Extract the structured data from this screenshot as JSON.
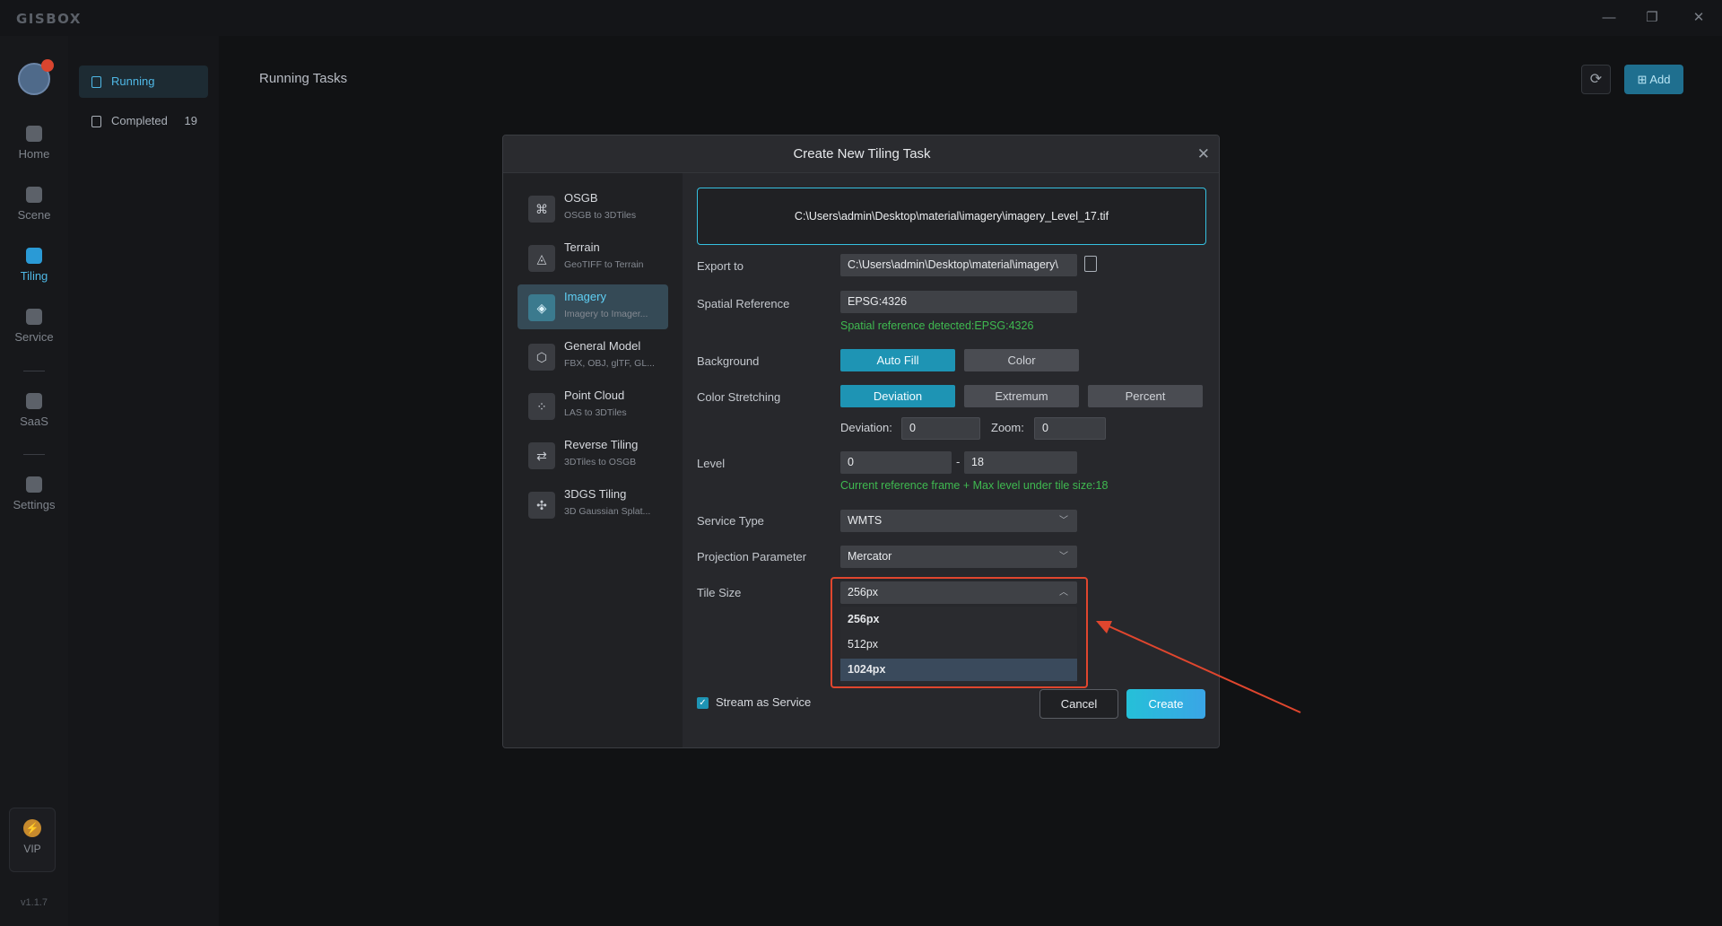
{
  "app": {
    "logo": "GISBOX",
    "version": "v1.1.7"
  },
  "window_controls": {
    "minimize": "—",
    "restore": "❐",
    "close": "✕"
  },
  "rail": {
    "items": [
      {
        "label": "Home"
      },
      {
        "label": "Scene"
      },
      {
        "label": "Tiling"
      },
      {
        "label": "Service"
      },
      {
        "label": "SaaS"
      },
      {
        "label": "Settings"
      }
    ],
    "vip": "VIP"
  },
  "subnav": {
    "running": "Running",
    "completed": "Completed",
    "completed_count": "19"
  },
  "main": {
    "title": "Running Tasks",
    "add_label": "Add",
    "refresh_icon": "⟳"
  },
  "dialog": {
    "title": "Create New Tiling Task",
    "types": [
      {
        "name": "OSGB",
        "desc": "OSGB to 3DTiles",
        "icon": "⌘"
      },
      {
        "name": "Terrain",
        "desc": "GeoTIFF to Terrain",
        "icon": "◬"
      },
      {
        "name": "Imagery",
        "desc": "Imagery to Imager...",
        "icon": "◈"
      },
      {
        "name": "General Model",
        "desc": "FBX, OBJ, glTF, GL...",
        "icon": "⬡"
      },
      {
        "name": "Point Cloud",
        "desc": "LAS to 3DTiles",
        "icon": "⁘"
      },
      {
        "name": "Reverse Tiling",
        "desc": "3DTiles to OSGB",
        "icon": "⇄"
      },
      {
        "name": "3DGS Tiling",
        "desc": "3D Gaussian Splat...",
        "icon": "✣"
      }
    ],
    "source_file": "C:\\Users\\admin\\Desktop\\material\\imagery\\imagery_Level_17.tif",
    "export_label": "Export to",
    "export_value": "C:\\Users\\admin\\Desktop\\material\\imagery\\",
    "spatial_label": "Spatial Reference",
    "spatial_value": "EPSG:4326",
    "spatial_msg": "Spatial reference detected:EPSG:4326",
    "background_label": "Background",
    "background_opts": [
      "Auto Fill",
      "Color"
    ],
    "stretch_label": "Color Stretching",
    "stretch_opts": [
      "Deviation",
      "Extremum",
      "Percent"
    ],
    "deviation_label": "Deviation:",
    "deviation_value": "0",
    "zoom_label": "Zoom:",
    "zoom_value": "0",
    "level_label": "Level",
    "level_min": "0",
    "level_dash": "-",
    "level_max": "18",
    "level_msg": "Current reference frame + Max level under tile size:18",
    "service_label": "Service Type",
    "service_value": "WMTS",
    "projection_label": "Projection Parameter",
    "projection_value": "Mercator",
    "tilesize_label": "Tile Size",
    "tilesize_value": "256px",
    "tilesize_options": [
      "256px",
      "512px",
      "1024px"
    ],
    "stream_label": "Stream as Service",
    "cancel": "Cancel",
    "create": "Create"
  },
  "colors": {
    "accent": "#1e94b4",
    "highlight": "#e0462e",
    "success": "#3fb950"
  }
}
